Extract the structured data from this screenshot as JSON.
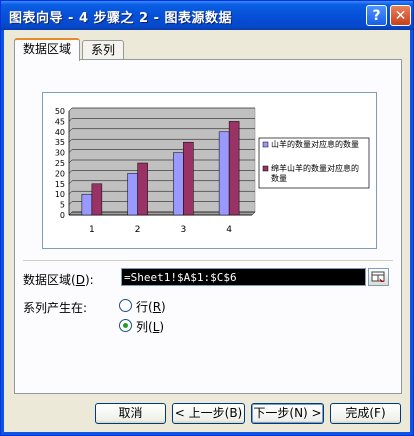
{
  "window": {
    "title": "图表向导 - 4 步骤之 2 - 图表源数据",
    "help_label": "?",
    "close_label": "✕"
  },
  "tabs": [
    {
      "label": "数据区域",
      "active": true
    },
    {
      "label": "系列",
      "active": false
    }
  ],
  "form": {
    "range_label": "数据区域",
    "range_key": "D",
    "range_colon": ":",
    "range_value": "=Sheet1!$A$1:$C$6",
    "series_in_label": "系列产生在:",
    "options": [
      {
        "label": "行",
        "key": "R",
        "selected": false
      },
      {
        "label": "列",
        "key": "L",
        "selected": true
      }
    ]
  },
  "buttons": {
    "cancel": "取消",
    "back": "< 上一步(B)",
    "next": "下一步(N) >",
    "finish": "完成(F)"
  },
  "chart_data": {
    "type": "bar",
    "categories": [
      "1",
      "2",
      "3",
      "4"
    ],
    "series": [
      {
        "name": "山羊的数量对应息的数量",
        "values": [
          10,
          20,
          30,
          40
        ],
        "color": "#9999ff"
      },
      {
        "name": "绵羊山羊的数量对应息的数量",
        "values": [
          15,
          25,
          35,
          45
        ],
        "color": "#993366"
      }
    ],
    "ylim": [
      0,
      50
    ],
    "yticks": [
      "0",
      "5",
      "10",
      "15",
      "20",
      "25",
      "30",
      "35",
      "40",
      "45",
      "50"
    ],
    "plot_background": "#c0c0c0",
    "grid": true,
    "legend_position": "right"
  }
}
